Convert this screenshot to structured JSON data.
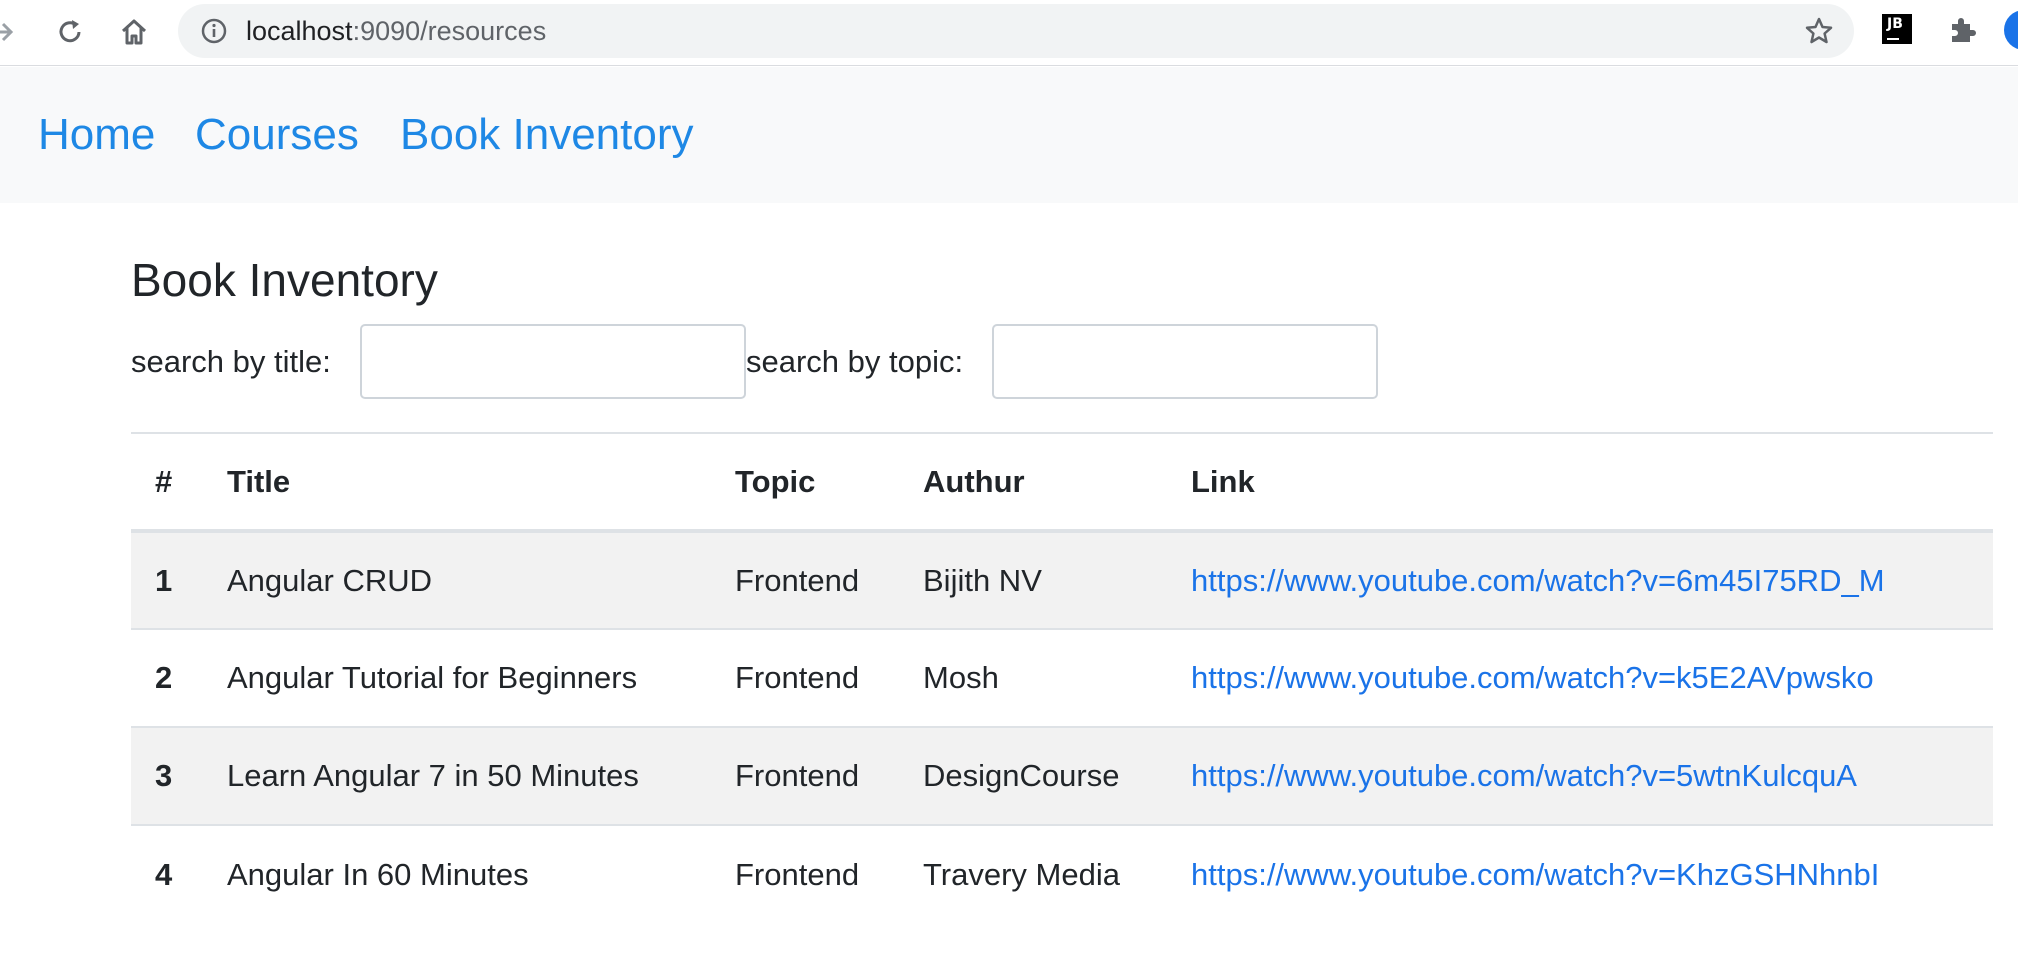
{
  "browser": {
    "url_host": "localhost",
    "url_rest": ":9090/resources",
    "extension_label": "JB"
  },
  "nav": {
    "links": [
      "Home",
      "Courses",
      "Book Inventory"
    ]
  },
  "main": {
    "title": "Book Inventory",
    "search_title_label": "search by title:",
    "search_title_value": "",
    "search_topic_label": "search by topic:",
    "search_topic_value": ""
  },
  "table": {
    "headers": [
      "#",
      "Title",
      "Topic",
      "Authur",
      "Link"
    ],
    "rows": [
      {
        "num": "1",
        "title": "Angular CRUD",
        "topic": "Frontend",
        "author": "Bijith NV",
        "link": "https://www.youtube.com/watch?v=6m45I75RD_M"
      },
      {
        "num": "2",
        "title": "Angular Tutorial for Beginners",
        "topic": "Frontend",
        "author": "Mosh",
        "link": "https://www.youtube.com/watch?v=k5E2AVpwsko"
      },
      {
        "num": "3",
        "title": "Learn Angular 7 in 50 Minutes",
        "topic": "Frontend",
        "author": "DesignCourse",
        "link": "https://www.youtube.com/watch?v=5wtnKulcquA"
      },
      {
        "num": "4",
        "title": "Angular In 60 Minutes",
        "topic": "Frontend",
        "author": "Travery Media",
        "link": "https://www.youtube.com/watch?v=KhzGSHNhnbI"
      }
    ]
  },
  "colors": {
    "link": "#1e88e5",
    "navbar_bg": "#f8f9fa",
    "stripe": "#f2f2f2"
  }
}
